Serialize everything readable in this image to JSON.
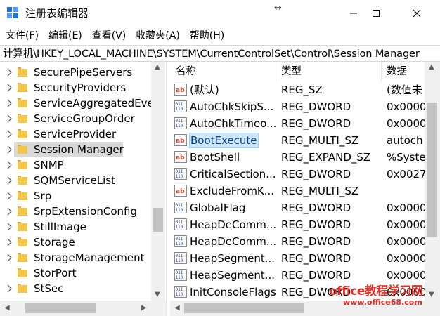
{
  "window": {
    "title": "注册表编辑器",
    "colors": {
      "selection_bg": "#cce8ff",
      "selection_border": "#99d1ff",
      "tree_highlight": "#d9d9d9",
      "folder": "#f3c74c",
      "watermark": "#d9322a"
    }
  },
  "menu": [
    {
      "label": "文件(F)"
    },
    {
      "label": "编辑(E)"
    },
    {
      "label": "查看(V)"
    },
    {
      "label": "收藏夹(A)"
    },
    {
      "label": "帮助(H)"
    }
  ],
  "address": "计算机\\HKEY_LOCAL_MACHINE\\SYSTEM\\CurrentControlSet\\Control\\Session Manager",
  "tree": {
    "items": [
      {
        "label": "SecurePipeServers",
        "expandable": true
      },
      {
        "label": "SecurityProviders",
        "expandable": true
      },
      {
        "label": "ServiceAggregatedEve",
        "expandable": true
      },
      {
        "label": "ServiceGroupOrder",
        "expandable": true
      },
      {
        "label": "ServiceProvider",
        "expandable": true
      },
      {
        "label": "Session Manager",
        "expandable": true,
        "selected": true
      },
      {
        "label": "SNMP",
        "expandable": true
      },
      {
        "label": "SQMServiceList",
        "expandable": true
      },
      {
        "label": "Srp",
        "expandable": true
      },
      {
        "label": "SrpExtensionConfig",
        "expandable": true
      },
      {
        "label": "StillImage",
        "expandable": true
      },
      {
        "label": "Storage",
        "expandable": true
      },
      {
        "label": "StorageManagement",
        "expandable": true
      },
      {
        "label": "StorPort",
        "expandable": false
      },
      {
        "label": "StSec",
        "expandable": true
      }
    ]
  },
  "list": {
    "headers": {
      "name": "名称",
      "type": "类型",
      "data": "数据"
    },
    "rows": [
      {
        "icon": "string-value-icon",
        "name": "(默认)",
        "type": "REG_SZ",
        "data": "(数值未"
      },
      {
        "icon": "binary-value-icon",
        "name": "AutoChkSkipS...",
        "type": "REG_DWORD",
        "data": "0x0000"
      },
      {
        "icon": "binary-value-icon",
        "name": "AutoChkTimeo...",
        "type": "REG_DWORD",
        "data": "0x0000"
      },
      {
        "icon": "string-value-icon",
        "name": "BootExecute",
        "type": "REG_MULTI_SZ",
        "data": "autoch",
        "selected": true
      },
      {
        "icon": "string-value-icon",
        "name": "BootShell",
        "type": "REG_EXPAND_SZ",
        "data": "%Syste"
      },
      {
        "icon": "binary-value-icon",
        "name": "CriticalSection...",
        "type": "REG_DWORD",
        "data": "0x0027"
      },
      {
        "icon": "string-value-icon",
        "name": "ExcludeFromK...",
        "type": "REG_MULTI_SZ",
        "data": ""
      },
      {
        "icon": "binary-value-icon",
        "name": "GlobalFlag",
        "type": "REG_DWORD",
        "data": "0x0000"
      },
      {
        "icon": "binary-value-icon",
        "name": "HeapDeComm...",
        "type": "REG_DWORD",
        "data": "0x0000"
      },
      {
        "icon": "binary-value-icon",
        "name": "HeapDeComm...",
        "type": "REG_DWORD",
        "data": "0x0000"
      },
      {
        "icon": "binary-value-icon",
        "name": "HeapSegment...",
        "type": "REG_DWORD",
        "data": "0x0000"
      },
      {
        "icon": "binary-value-icon",
        "name": "HeapSegment...",
        "type": "REG_DWORD",
        "data": "0x0000"
      },
      {
        "icon": "binary-value-icon",
        "name": "InitConsoleFlags",
        "type": "REG_DWORD",
        "data": "0x0000"
      }
    ]
  },
  "watermark": {
    "title": "office教程学习网",
    "url": "www.office68.com"
  }
}
